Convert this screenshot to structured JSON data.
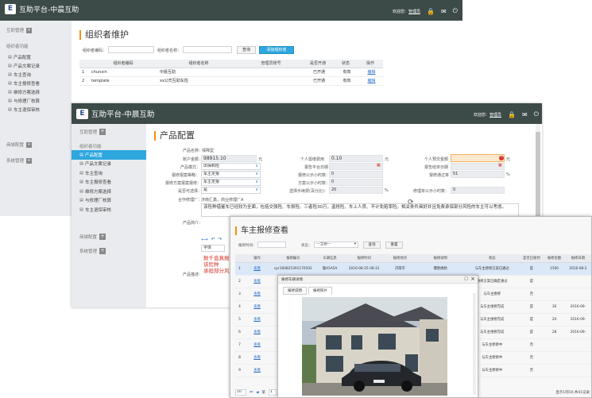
{
  "brand": {
    "logo_text": "E",
    "app_title": "互助平台-中晨互助"
  },
  "topbar": {
    "welcome": "欢迎您：",
    "user": "管理员"
  },
  "icons": {
    "lock": "lock-icon",
    "mail": "mail-icon",
    "power": "power-icon"
  },
  "w1": {
    "page_title": "组织者维护",
    "sidebar": {
      "group1": "互助管理",
      "group2": "组织者功能",
      "items": [
        "产品配置",
        "产品文案记录",
        "车主查询",
        "车主报修查看",
        "维修方案选择",
        "与修理厂核算",
        "车主退保审核"
      ],
      "group3": "商城配置",
      "group4": "系统管理"
    },
    "filters": {
      "code_label": "组织者编码：",
      "name_label": "组织者名称：",
      "search": "查询",
      "add": "添加组织者"
    },
    "table": {
      "headers": [
        "",
        "组织者编码",
        "组织者名称",
        "管理员账号",
        "是否开通",
        "状态",
        "操作"
      ],
      "rows": [
        [
          "1",
          "chunxin",
          "中晨互助",
          "",
          "已开通",
          "有效",
          "编辑"
        ],
        [
          "2",
          "template",
          "xx公司互助车险",
          "",
          "已开通",
          "有效",
          "编辑"
        ]
      ]
    }
  },
  "w2": {
    "page_title": "产品配置",
    "sidebar": {
      "group1": "互助管理",
      "group2": "组织者功能",
      "items": [
        "产品配置",
        "产品文案记录",
        "车主查询",
        "车主报修查看",
        "维修方案选择",
        "与修理厂核算",
        "车主退保审核"
      ],
      "group3": "商城配置",
      "group4": "系统管理"
    },
    "form": {
      "product_name_label": "产品名称：",
      "product_name": "保障型",
      "account_amount_label": "账户金额：",
      "account_amount": "98915.10",
      "yuan": "元",
      "member_fee_label": "个人需缴费用",
      "member_fee": "0.10",
      "personal_pay_label": "个人预交金额",
      "product_mode_label": "产品模式：",
      "product_mode": "出保和险",
      "platform_date_label": "报告平台日期",
      "platform_date": "",
      "open_date_label": "报告结单日期",
      "repair_rule_label": "报修报案等略：",
      "repair_rule": "车主定报",
      "report_hours_label": "报修公示小时数：",
      "report_hours": "0",
      "pass_rate_label": "报修通过率",
      "pass_rate": "51",
      "percent": "%",
      "repair_plan_label": "报修方案报案报修：",
      "repair_plan": "车主定报",
      "plan_hours_label": "方案公示小时数：",
      "plan_hours": "0",
      "can_choose_label": "是否可选择：",
      "can_choose": "是",
      "fee_rate_label": "选择手续费(百分比)：",
      "fee_rate": "20",
      "manage_hours_label": "修理单公示小时数：",
      "manage_hours": "0",
      "partner_label": "合作修理厂：",
      "partner": "济南汇鑫，商业修理厂A",
      "intro_label": "产品简介：",
      "intro_text": "该险种借鉴车已经较为全面，包括交强险、车损险、三者险30万，盗抢险、车上人员、不计免赔率险。相关条件具好并且免费承保部分风险的车主可以考虑。",
      "font_label": "字体",
      "red_text": "数千直真报\n该险种\n承担部分风",
      "desc_label": "产品描述："
    }
  },
  "w3": {
    "page_title": "车主报修查看",
    "filters": {
      "time_label": "报修时间：",
      "status_label": "状态：",
      "status_value": "---全部---",
      "search": "查询",
      "reset": "重置"
    },
    "table": {
      "headers": [
        "",
        "操作",
        "报修编号",
        "车辆信息",
        "报修时间",
        "报修地点",
        "报修说明",
        "状态",
        "是否已收到",
        "报修金额",
        "报修日期"
      ],
      "rows": [
        [
          "1",
          "查看",
          "cpr160825391170592",
          "鲁A5A5A",
          "2016-08-25 08:31",
          "济南市",
          "爆胎换胎",
          "与车主修修方案已通过",
          "是",
          "1500",
          "2016-08-2"
        ],
        [
          "2",
          "查看",
          "",
          "",
          "",
          "",
          "",
          "维修方案已确定通过",
          "是",
          "",
          ""
        ],
        [
          "3",
          "查看",
          "",
          "",
          "",
          "",
          "",
          "与车主维修",
          "否",
          "",
          ""
        ],
        [
          "4",
          "查看",
          "",
          "",
          "",
          "",
          "",
          "与车主维修完成",
          "是",
          "30",
          "2016-09-"
        ],
        [
          "5",
          "查看",
          "",
          "",
          "",
          "",
          "",
          "与车主维修完成",
          "是",
          "20",
          "2016-09-"
        ],
        [
          "6",
          "查看",
          "",
          "",
          "",
          "",
          "",
          "与车主维修完成",
          "是",
          "28",
          "2016-09-"
        ],
        [
          "7",
          "查看",
          "",
          "",
          "",
          "",
          "",
          "与车主修修中",
          "否",
          "",
          ""
        ],
        [
          "8",
          "查看",
          "",
          "",
          "",
          "",
          "",
          "与车主修修中",
          "否",
          "",
          ""
        ],
        [
          "9",
          "查看",
          "",
          "",
          "",
          "",
          "",
          "与车主修修中",
          "否",
          "",
          ""
        ]
      ]
    },
    "pager": {
      "size": "10",
      "page_label": "第",
      "page_num": "1",
      "of": "共1页",
      "info": "显示1到10,共41记录"
    },
    "dialog": {
      "title": "报修车辆详情",
      "tab1": "报修说明",
      "tab2": "报修照片",
      "close": "×",
      "max": "□"
    }
  }
}
